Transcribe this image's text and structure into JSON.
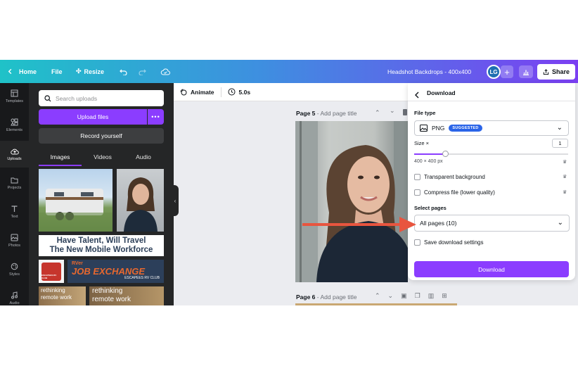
{
  "topbar": {
    "home_label": "Home",
    "file_label": "File",
    "resize_label": "Resize",
    "doc_title": "Headshot Backdrops - 400x400",
    "avatar_initials": "LG",
    "add_label": "+",
    "share_label": "Share"
  },
  "rail": {
    "items": [
      {
        "label": "Templates",
        "icon": "templates-icon"
      },
      {
        "label": "Elements",
        "icon": "elements-icon"
      },
      {
        "label": "Uploads",
        "icon": "uploads-icon"
      },
      {
        "label": "Projects",
        "icon": "projects-icon"
      },
      {
        "label": "Text",
        "icon": "text-icon"
      },
      {
        "label": "Photos",
        "icon": "photos-icon"
      },
      {
        "label": "Styles",
        "icon": "styles-icon"
      },
      {
        "label": "Audio",
        "icon": "audio-icon"
      }
    ]
  },
  "panel": {
    "search_placeholder": "Search uploads",
    "upload_label": "Upload files",
    "more_label": "•••",
    "record_label": "Record yourself",
    "tabs": [
      "Images",
      "Videos",
      "Audio"
    ],
    "banner1_line1": "Have Talent, Will Travel",
    "banner1_line2": "The New Mobile Workforce",
    "banner2_small": "RVer",
    "banner2_title": "JOB EXCHANGE",
    "banner2_sub": "ESCAPEES RV CLUB",
    "logo_text": "ESCAPEES RV CLUB",
    "thumb_text1": "rethinking",
    "thumb_text2": "remote work"
  },
  "canvas": {
    "animate_label": "Animate",
    "duration_label": "5.0s",
    "page5_label": "Page 5",
    "page5_title": "- Add page title",
    "page6_label": "Page 6",
    "page6_title": "- Add page title"
  },
  "download": {
    "title": "Download",
    "filetype_label": "File type",
    "filetype_value": "PNG",
    "suggested_badge": "SUGGESTED",
    "size_label": "Size ×",
    "size_value": "1",
    "size_px": "400 × 400 px",
    "transparent_label": "Transparent background",
    "compress_label": "Compress file (lower quality)",
    "select_pages_label": "Select pages",
    "pages_value": "All pages (10)",
    "save_settings_label": "Save download settings",
    "download_button": "Download"
  },
  "colors": {
    "accent": "#8b3dff",
    "arrow": "#e8553f",
    "badge": "#2a64e8"
  }
}
